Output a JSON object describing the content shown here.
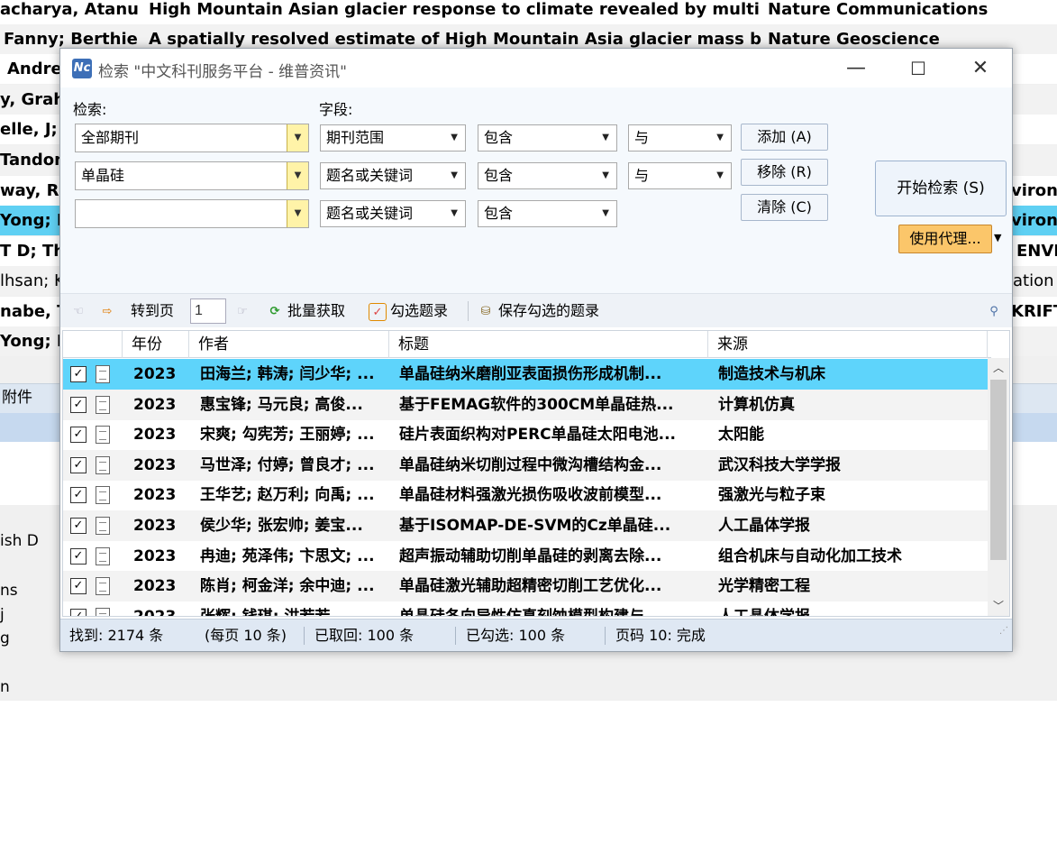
{
  "background": {
    "rows": [
      {
        "author": "acharya, Atanu",
        "title": "High Mountain Asian glacier response to climate revealed by multi",
        "source": "Nature Communications"
      },
      {
        "author": "Fanny; Berthie",
        "title": "A spatially resolved estimate of High Mountain Asia glacier mass b",
        "source": "Nature Geoscience"
      },
      {
        "author": "Andre",
        "title": "",
        "source": ""
      },
      {
        "author": "y, Grah",
        "title": "",
        "source": ""
      },
      {
        "author": "elle, J; I",
        "title": "",
        "source": ""
      },
      {
        "author": "Tandon",
        "title": "",
        "source": ""
      },
      {
        "author": "way, R",
        "title": "",
        "source": "vironi"
      },
      {
        "author": "Yong; P",
        "title": "",
        "source": "vironi"
      },
      {
        "author": "T D; Tho",
        "title": "",
        "source": "ENVI"
      },
      {
        "author": "lhsan; K",
        "title": "",
        "source": "ation"
      },
      {
        "author": "nabe, T",
        "title": "",
        "source": "KRIFT"
      },
      {
        "author": "Yong; Li",
        "title": "",
        "source": ""
      }
    ],
    "attachment_label": "附件",
    "fragments": [
      "ish D",
      "ns",
      "j",
      "g",
      "n"
    ]
  },
  "dialog": {
    "title": "检索 \"中文科刊服务平台 - 维普资讯\"",
    "app_icon_text": "Nc",
    "window_controls": {
      "minimize": "—",
      "maximize": "☐",
      "close": "✕"
    },
    "labels": {
      "search": "检索:",
      "field": "字段:"
    },
    "criteria": [
      {
        "value": "全部期刊",
        "field": "期刊范围",
        "op": "包含",
        "logic": "与"
      },
      {
        "value": "单晶硅",
        "field": "题名或关键词",
        "op": "包含",
        "logic": "与"
      },
      {
        "value": "",
        "field": "题名或关键词",
        "op": "包含",
        "logic": ""
      }
    ],
    "buttons": {
      "add": "添加 (A)",
      "remove": "移除 (R)",
      "clear": "清除 (C)",
      "start": "开始检索 (S)",
      "proxy": "使用代理..."
    },
    "toolbar": {
      "goto_page": "转到页",
      "page_value": "1",
      "batch_get": "批量获取",
      "check_records": "勾选题录",
      "save_checked": "保存勾选的题录"
    },
    "columns": {
      "year": "年份",
      "author": "作者",
      "title": "标题",
      "source": "来源"
    },
    "results": [
      {
        "year": "2023",
        "author": "田海兰; 韩涛; 闫少华; ...",
        "title": "单晶硅纳米磨削亚表面损伤形成机制...",
        "source": "制造技术与机床"
      },
      {
        "year": "2023",
        "author": "惠宝锋; 马元良; 高俊...",
        "title": "基于FEMAG软件的300CM单晶硅热...",
        "source": "计算机仿真"
      },
      {
        "year": "2023",
        "author": "宋爽; 勾宪芳; 王丽婷; ...",
        "title": "硅片表面织构对PERC单晶硅太阳电池...",
        "source": "太阳能"
      },
      {
        "year": "2023",
        "author": "马世泽; 付婷; 曾良才; ...",
        "title": "单晶硅纳米切削过程中微沟槽结构金...",
        "source": "武汉科技大学学报"
      },
      {
        "year": "2023",
        "author": "王华艺; 赵万利; 向禹; ...",
        "title": "单晶硅材料强激光损伤吸收波前模型...",
        "source": "强激光与粒子束"
      },
      {
        "year": "2023",
        "author": "侯少华; 张宏帅; 姜宝...",
        "title": "基于ISOMAP-DE-SVM的Cz单晶硅...",
        "source": "人工晶体学报"
      },
      {
        "year": "2023",
        "author": "冉迪; 苑泽伟; 卞思文; ...",
        "title": "超声振动辅助切削单晶硅的剥离去除...",
        "source": "组合机床与自动化加工技术"
      },
      {
        "year": "2023",
        "author": "陈肖; 柯金洋; 余中迪; ...",
        "title": "单晶硅激光辅助超精密切削工艺优化...",
        "source": "光学精密工程"
      },
      {
        "year": "2023",
        "author": "张辉; 钱琪; 洪若若...",
        "title": "单晶硅各向异性仿真刻蚀模型构建与...",
        "source": "人工晶体学报"
      }
    ],
    "status": {
      "found": "找到: 2174 条",
      "per_page": "(每页 10 条)",
      "fetched": "已取回: 100 条",
      "checked": "已勾选: 100 条",
      "page": "页码 10: 完成"
    }
  }
}
